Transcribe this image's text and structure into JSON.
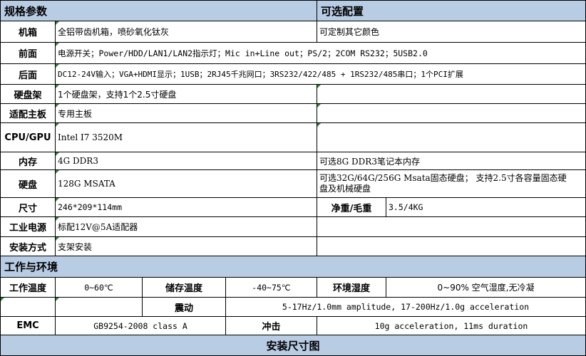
{
  "section_spec": "规格参数",
  "section_options": "可选配置",
  "rows": {
    "chassis": {
      "label": "机箱",
      "value": "全铝带齿机箱，喷砂氧化钛灰",
      "option": "可定制其它颜色"
    },
    "front": {
      "label": "前面",
      "value": "电源开关；Power/HDD/LAN1/LAN2指示灯；Mic in+Line out；PS/2；2COM RS232；5USB2.0"
    },
    "rear": {
      "label": "后面",
      "value": "DC12-24V输入；VGA+HDMI显示；1USB；2RJ45千兆网口；3RS232/422/485 + 1RS232/485串口；1个PCI扩展"
    },
    "hdd_bay": {
      "label": "硬盘架",
      "value": "1个硬盘架，支持1个2.5寸硬盘",
      "option": ""
    },
    "board": {
      "label": "适配主板",
      "value": "专用主板",
      "option": ""
    },
    "cpu": {
      "label": "CPU/GPU",
      "value": "Intel I7 3520M",
      "option": ""
    },
    "memory": {
      "label": "内存",
      "value": "4G DDR3",
      "option": "可选8G DDR3笔记本内存"
    },
    "disk": {
      "label": "硬盘",
      "value": "128G MSATA",
      "option": "可选32G/64G/256G Msata固态硬盘； 支持2.5寸各容量固态硬盘及机械硬盘"
    },
    "size": {
      "label": "尺寸",
      "value": "246*209*114mm",
      "weight_label": "净重/毛重",
      "weight_value": "3.5/4KG"
    },
    "power": {
      "label": "工业电源",
      "value": "标配12V@5A适配器",
      "option": ""
    },
    "mount": {
      "label": "安装方式",
      "value": "支架安装",
      "option": ""
    }
  },
  "section_env": "工作与环境",
  "env": {
    "op_temp_label": "工作温度",
    "op_temp": "0~60℃",
    "storage_temp_label": "储存温度",
    "storage_temp": "-40~75℃",
    "humidity_label": "环境湿度",
    "humidity": "0~90% 空气湿度,无冷凝",
    "vibration_label": "震动",
    "vibration": "5-17Hz/1.0mm amplitude, 17-200Hz/1.0g acceleration",
    "emc_label": "EMC",
    "emc": "GB9254-2008 class A",
    "shock_label": "冲击",
    "shock": "10g acceleration, 11ms duration"
  },
  "section_install": "安装尺寸图"
}
